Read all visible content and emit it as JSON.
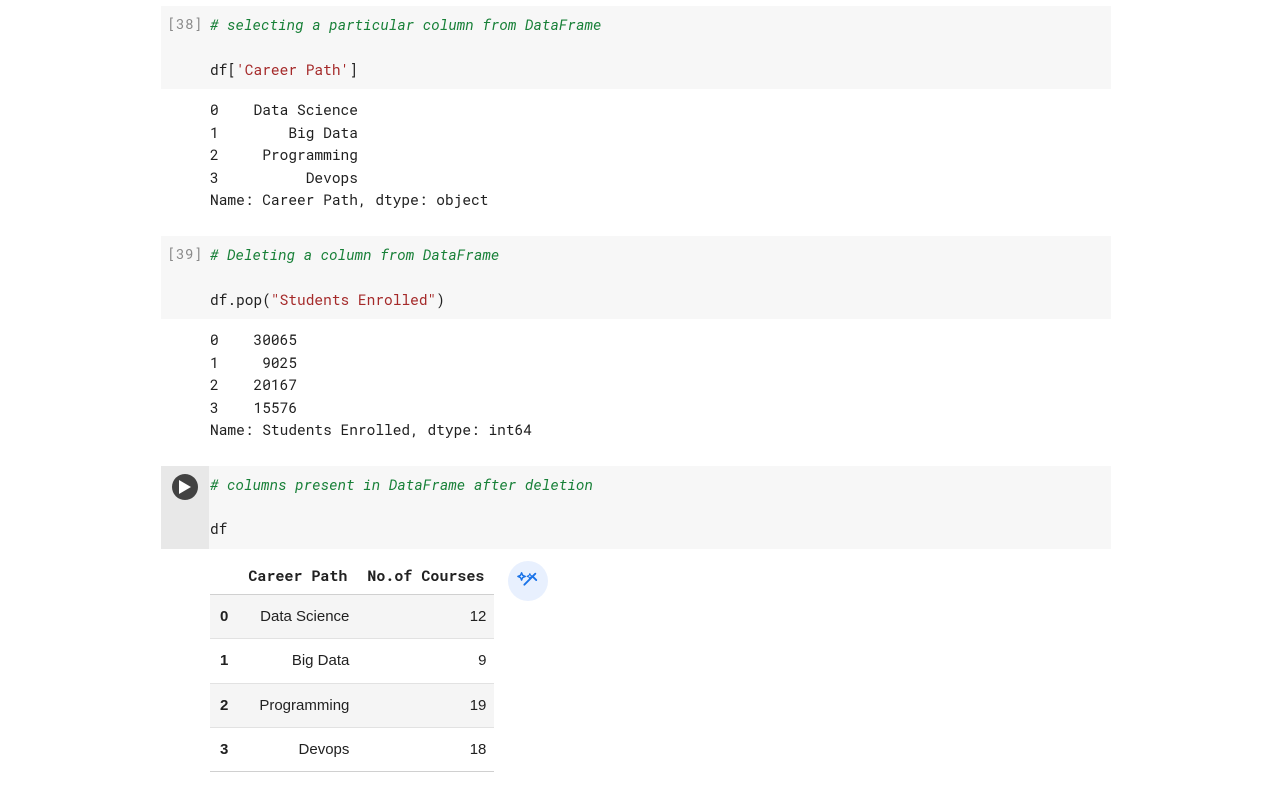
{
  "cells": [
    {
      "prompt": "[38]",
      "running": false,
      "code_html": "<span class=\"c-comment\"># selecting a particular column from DataFrame</span>\n\ndf[<span class=\"c-str\">'Career Path'</span>]",
      "output_text": "0    Data Science\n1        Big Data\n2     Programming\n3          Devops\nName: Career Path, dtype: object"
    },
    {
      "prompt": "[39]",
      "running": false,
      "code_html": "<span class=\"c-comment\"># Deleting a column from DataFrame</span>\n\ndf.pop(<span class=\"c-str\">\"Students Enrolled\"</span>)",
      "output_text": "0    30065\n1     9025\n2    20167\n3    15576\nName: Students Enrolled, dtype: int64"
    },
    {
      "prompt": "",
      "running": true,
      "code_html": "<span class=\"c-comment\"># columns present in DataFrame after deletion</span>\n\ndf",
      "output_table": {
        "columns": [
          "Career Path",
          "No.of Courses"
        ],
        "rows": [
          {
            "index": "0",
            "career": "Data Science",
            "courses": "12"
          },
          {
            "index": "1",
            "career": "Big Data",
            "courses": "9"
          },
          {
            "index": "2",
            "career": "Programming",
            "courses": "19"
          },
          {
            "index": "3",
            "career": "Devops",
            "courses": "18"
          }
        ]
      }
    }
  ]
}
